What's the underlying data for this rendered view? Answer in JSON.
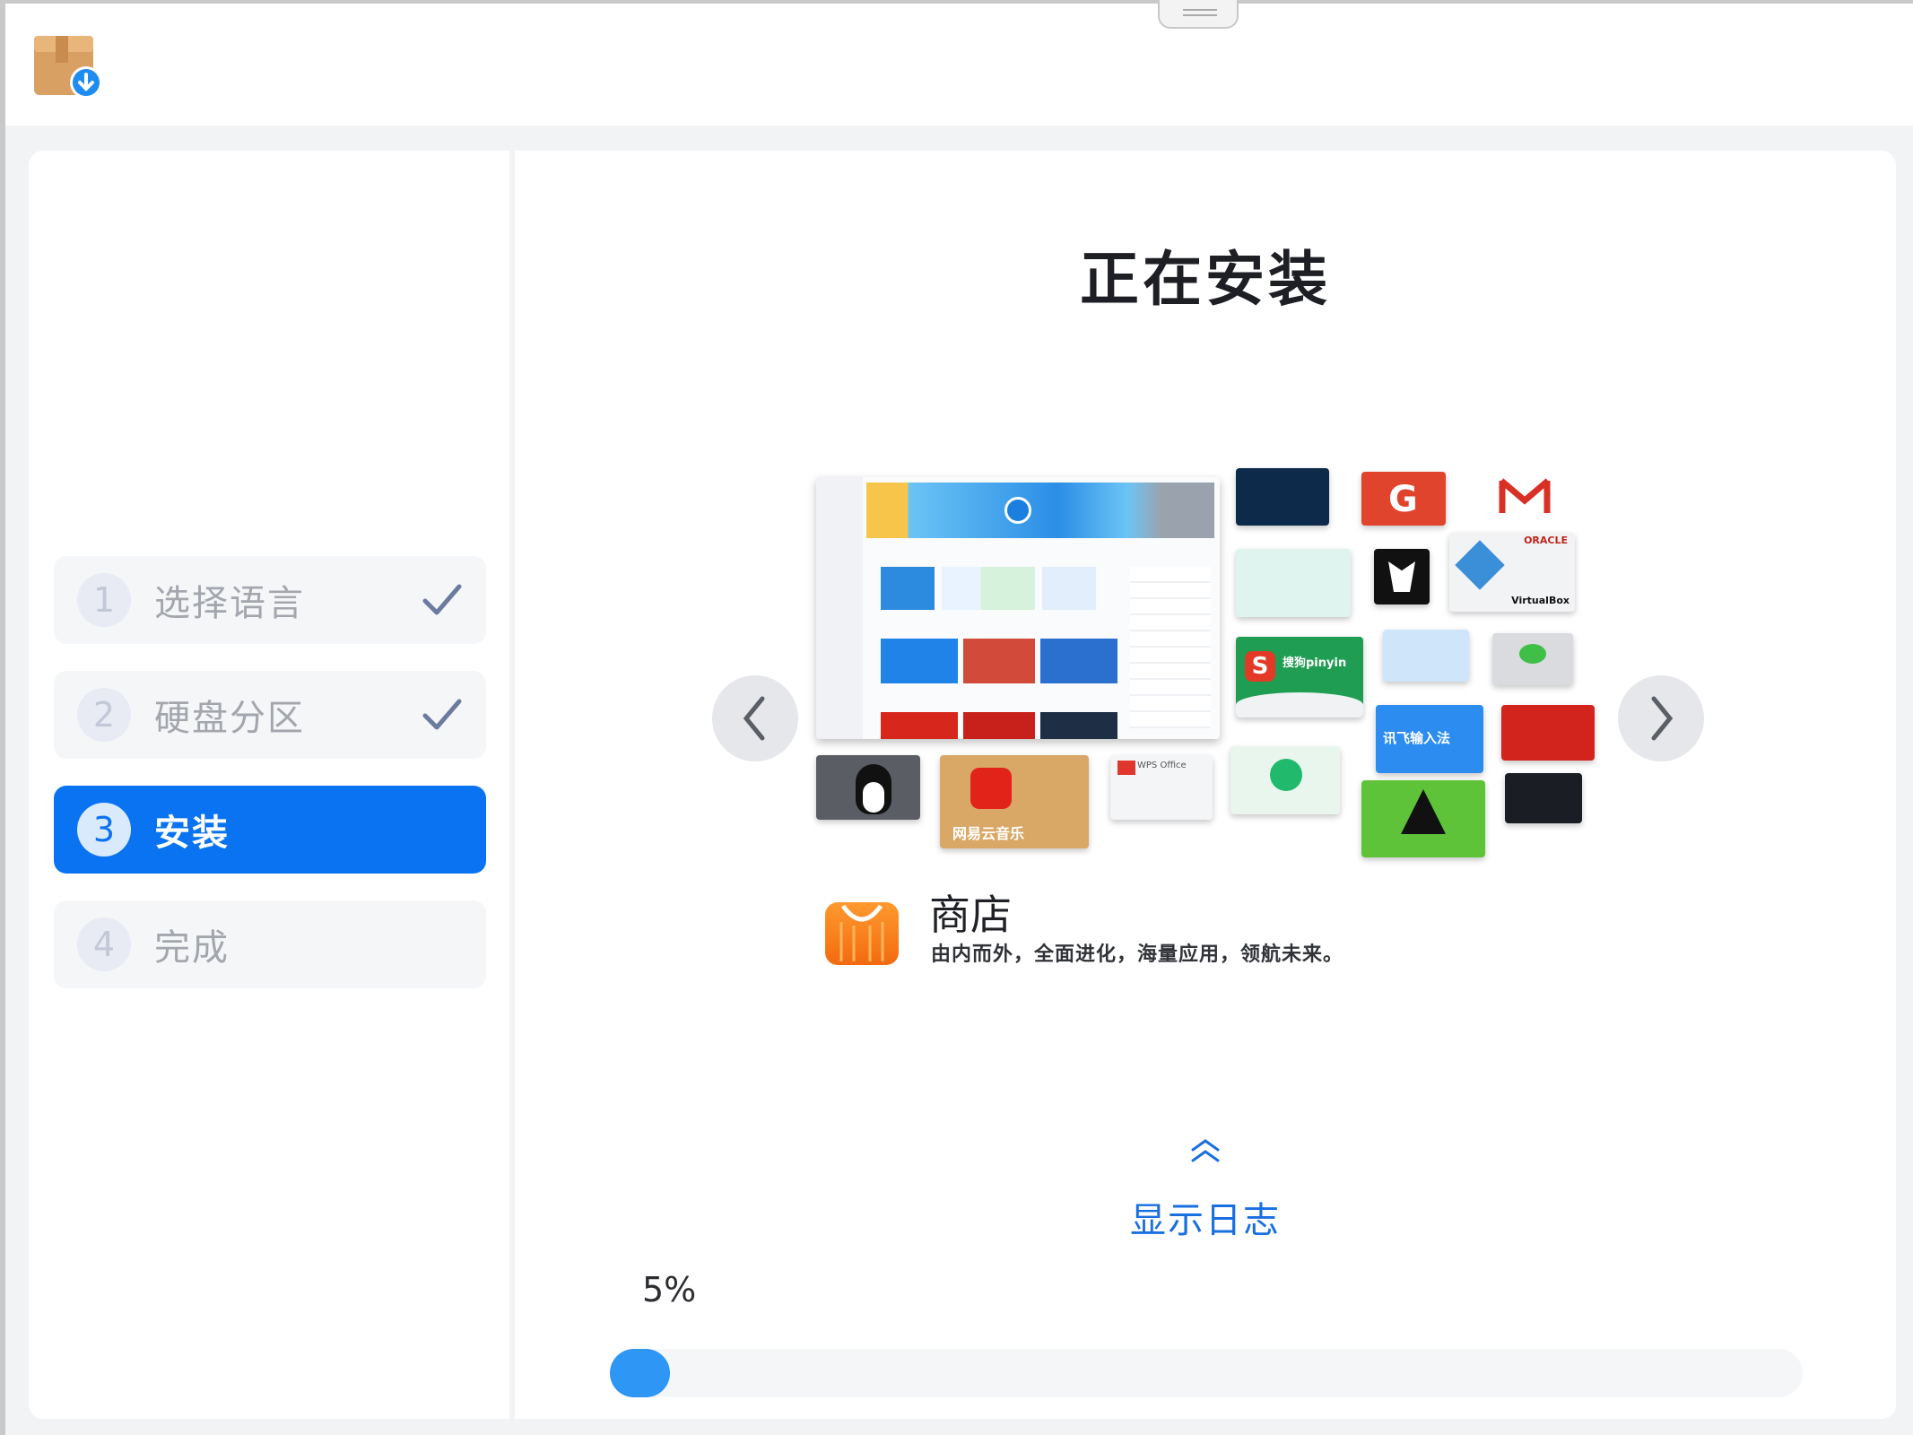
{
  "window": {
    "title_icon": "installer-package-icon"
  },
  "sidebar": {
    "steps": [
      {
        "number": "1",
        "label": "选择语言",
        "state": "done"
      },
      {
        "number": "2",
        "label": "硬盘分区",
        "state": "done"
      },
      {
        "number": "3",
        "label": "安装",
        "state": "active"
      },
      {
        "number": "4",
        "label": "完成",
        "state": "pending"
      }
    ]
  },
  "main": {
    "title": "正在安装",
    "slide": {
      "app_name": "商店",
      "description": "由内而外，全面进化，海量应用，领航未来。",
      "tile_texts": {
        "netease_music": "网易云音乐",
        "sogou": "搜狗pinyin",
        "iflytek": "讯飞输入法",
        "virtualbox": "VirtualBox",
        "oracle": "ORACLE",
        "wps": "WPS Office"
      }
    },
    "log_toggle": "显示日志",
    "progress": {
      "percent_text": "5%",
      "fraction": 0.05
    }
  },
  "colors": {
    "accent": "#0a73f2",
    "progress": "#2e96f4",
    "link": "#1a6fe0"
  }
}
